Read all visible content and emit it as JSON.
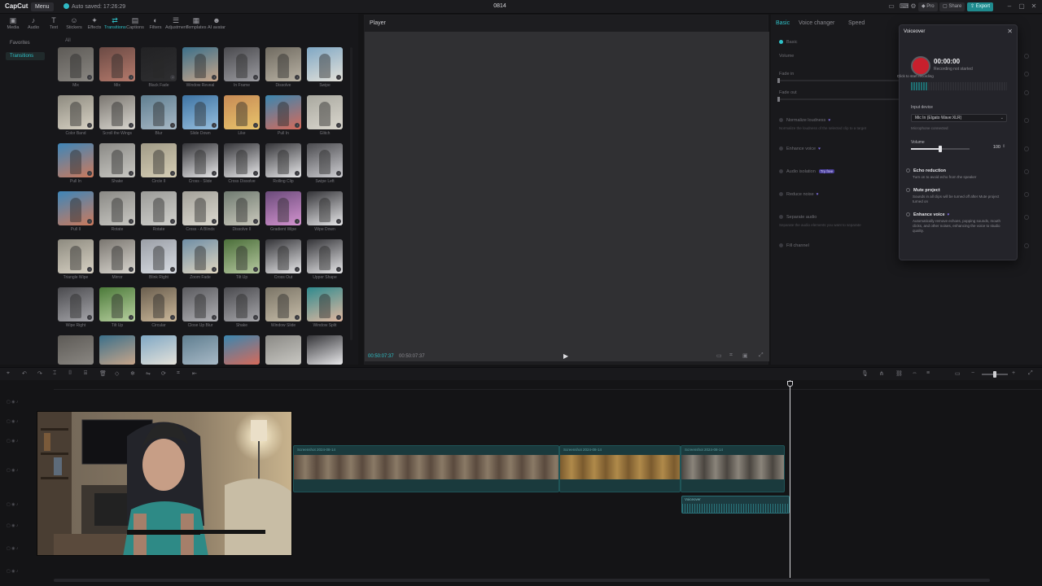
{
  "titlebar": {
    "app_name": "CapCut",
    "menu_label": "Menu",
    "autosave": "Auto saved: 17:26:29",
    "project_name": "0814",
    "pro_label": "Pro",
    "share_label": "Share",
    "export_label": "Export"
  },
  "toolbar": {
    "tools": [
      {
        "label": "Media",
        "icon": "media-icon"
      },
      {
        "label": "Audio",
        "icon": "audio-icon"
      },
      {
        "label": "Text",
        "icon": "text-icon"
      },
      {
        "label": "Stickers",
        "icon": "sticker-icon"
      },
      {
        "label": "Effects",
        "icon": "effects-icon"
      },
      {
        "label": "Transitions",
        "icon": "transitions-icon"
      },
      {
        "label": "Captions",
        "icon": "captions-icon"
      },
      {
        "label": "Filters",
        "icon": "filters-icon"
      },
      {
        "label": "Adjustment",
        "icon": "adjustment-icon"
      },
      {
        "label": "Templates",
        "icon": "templates-icon"
      },
      {
        "label": "AI avatar",
        "icon": "avatar-icon"
      }
    ],
    "active_index": 5
  },
  "leftnav": {
    "items": [
      "Favorites",
      "Transitions"
    ],
    "active_index": 1
  },
  "grid": {
    "header": "All",
    "items": [
      "Mix",
      "Mix",
      "Black Fade",
      "Window Reveal",
      "In Frame",
      "Dissolve",
      "Swipe",
      "Color Band",
      "Scroll the Wings",
      "Blur",
      "Slide Down",
      "Like",
      "Pull In",
      "Glitch",
      "Pull In",
      "Shake",
      "Circle II",
      "Cross - Slide",
      "Cross Dissolve",
      "Rolling Clip",
      "Swipe Left",
      "Pull II",
      "Rotate",
      "Rotate",
      "Cross - A Blinds",
      "Dissolve II",
      "Gradient Wipe",
      "Wipe Down",
      "Triangle Wipe",
      "Mirror",
      "Blink Right",
      "Zoom Fade",
      "Tilt Up",
      "Cross Out",
      "Upper Shape",
      "Wipe Right",
      "Tilt Up",
      "Circular",
      "Close Up Blur",
      "Shake",
      "Window Slide",
      "Window Split"
    ]
  },
  "player": {
    "title": "Player",
    "current_time": "00:50:07:37",
    "total_time": "00:50:07:37"
  },
  "rightpanel": {
    "tabs": [
      "Basic",
      "Voice changer",
      "Speed"
    ],
    "active_tab": 0,
    "section": "Basic",
    "rows": [
      {
        "label": "Volume"
      },
      {
        "label": "Fade in"
      },
      {
        "label": "Fade out"
      },
      {
        "label": "Normalize loudness",
        "desc": "Normalize the loudness of the selected clip to a target"
      },
      {
        "label": "Enhance voice"
      },
      {
        "label": "Audio isolation",
        "badge": "Try free"
      },
      {
        "label": "Reduce noise"
      },
      {
        "label": "Separate audio",
        "desc": "Separate the audio elements you want to separate"
      },
      {
        "label": "Fill channel"
      }
    ]
  },
  "voiceover": {
    "title": "Voiceover",
    "time": "00:00:00",
    "status": "Recording not started",
    "tooltip": "Click to start recording",
    "input_label": "Input device",
    "input_value": "Mic In (Elgato Wave:XLR)",
    "mic_hint": "Microphone connected",
    "volume_label": "Volume",
    "volume_value": "100",
    "volume_fraction": 0.5,
    "options": [
      {
        "label": "Echo reduction",
        "desc": "Turn on to avoid echo from the speaker"
      },
      {
        "label": "Mute project",
        "desc": "Sounds in all clips will be turned off after Mute project turned on"
      },
      {
        "label": "Enhance voice",
        "desc": "Automatically remove echoes, popping sounds, mouth clicks, and other noises, enhancing the voice to studio quality."
      }
    ],
    "colors": {
      "record": "#c8202d",
      "accent": "#2fc1c8"
    }
  },
  "timeline": {
    "clips": [
      {
        "name": "Screenshot 2024-08-14"
      },
      {
        "name": "Screenshot 2024-08-14"
      },
      {
        "name": "Screenshot 2024-08-14"
      }
    ],
    "audio_clip_name": "Voiceover"
  }
}
